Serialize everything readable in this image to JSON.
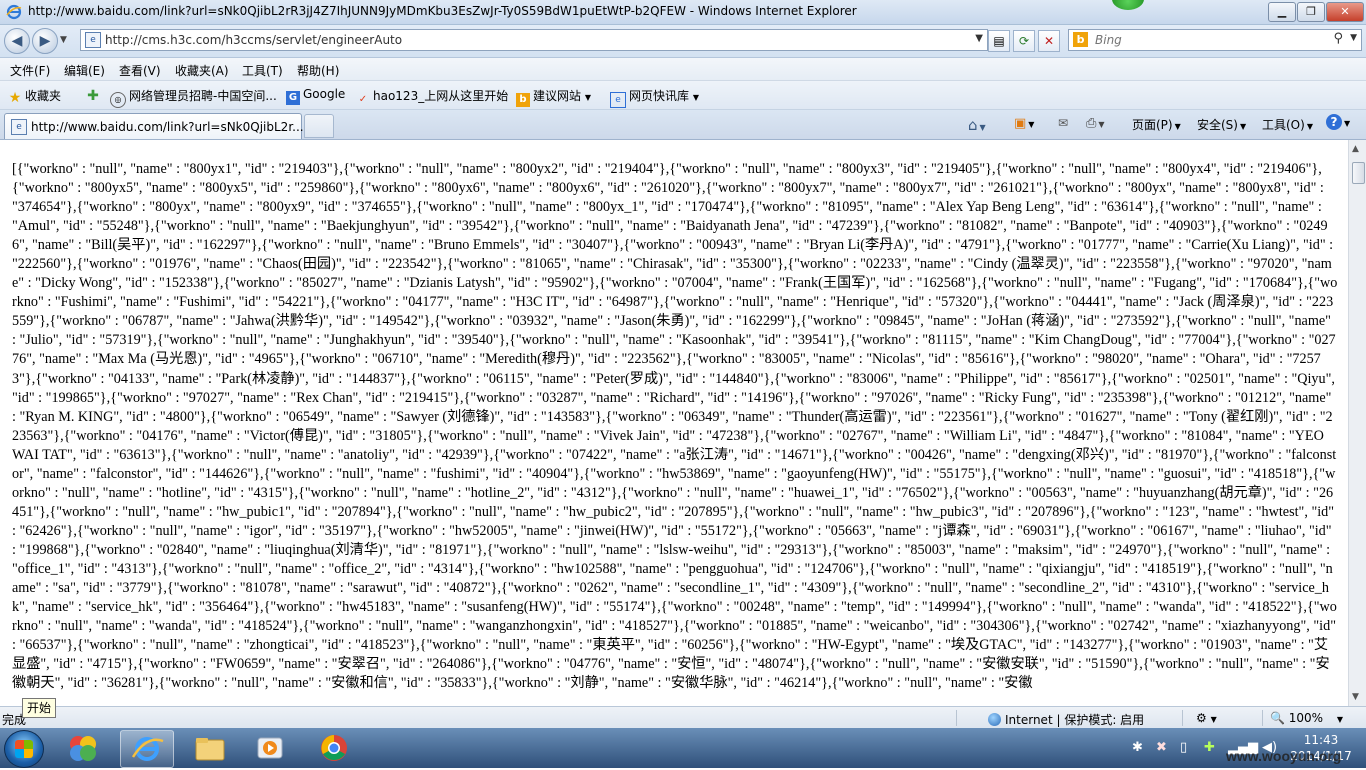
{
  "window": {
    "title": "http://www.baidu.com/link?url=sNk0QjibL2rR3jJ4Z7IhJUNN9JyMDmKbu3EsZwJr-Ty0S59BdW1puEtWtP-b2QFEW - Windows Internet Explorer"
  },
  "address": {
    "url": "http://cms.h3c.com/h3ccms/servlet/engineerAuto"
  },
  "search": {
    "placeholder": "Bing"
  },
  "menu": {
    "items": [
      "文件(F)",
      "编辑(E)",
      "查看(V)",
      "收藏夹(A)",
      "工具(T)",
      "帮助(H)"
    ]
  },
  "favorites": {
    "label": "收藏夹",
    "items": [
      "网络管理员招聘-中国空间...",
      "Google",
      "hao123_上网从这里开始",
      "建议网站",
      "网页快讯库"
    ]
  },
  "tab": {
    "label": "http://www.baidu.com/link?url=sNk0QjibL2r..."
  },
  "commandbar": {
    "page": "页面(P)",
    "safety": "安全(S)",
    "tools": "工具(O)"
  },
  "content": {
    "json_text": "[{\"workno\" : \"null\", \"name\" : \"800yx1\", \"id\" : \"219403\"},{\"workno\" : \"null\", \"name\" : \"800yx2\", \"id\" : \"219404\"},{\"workno\" : \"null\", \"name\" : \"800yx3\", \"id\" : \"219405\"},{\"workno\" : \"null\", \"name\" : \"800yx4\", \"id\" : \"219406\"},{\"workno\" : \"800yx5\", \"name\" : \"800yx5\", \"id\" : \"259860\"},{\"workno\" : \"800yx6\", \"name\" : \"800yx6\", \"id\" : \"261020\"},{\"workno\" : \"800yx7\", \"name\" : \"800yx7\", \"id\" : \"261021\"},{\"workno\" : \"800yx\", \"name\" : \"800yx8\", \"id\" : \"374654\"},{\"workno\" : \"800yx\", \"name\" : \"800yx9\", \"id\" : \"374655\"},{\"workno\" : \"null\", \"name\" : \"800yx_1\", \"id\" : \"170474\"},{\"workno\" : \"81095\", \"name\" : \"Alex Yap Beng Leng\", \"id\" : \"63614\"},{\"workno\" : \"null\", \"name\" : \"Amul\", \"id\" : \"55248\"},{\"workno\" : \"null\", \"name\" : \"Baekjunghyun\", \"id\" : \"39542\"},{\"workno\" : \"null\", \"name\" : \"Baidyanath Jena\", \"id\" : \"47239\"},{\"workno\" : \"81082\", \"name\" : \"Banpote\", \"id\" : \"40903\"},{\"workno\" : \"02496\", \"name\" : \"Bill(吴平)\", \"id\" : \"162297\"},{\"workno\" : \"null\", \"name\" : \"Bruno Emmels\", \"id\" : \"30407\"},{\"workno\" : \"00943\", \"name\" : \"Bryan Li(李丹A)\", \"id\" : \"4791\"},{\"workno\" : \"01777\", \"name\" : \"Carrie(Xu Liang)\", \"id\" : \"222560\"},{\"workno\" : \"01976\", \"name\" : \"Chaos(田园)\", \"id\" : \"223542\"},{\"workno\" : \"81065\", \"name\" : \"Chirasak\", \"id\" : \"35300\"},{\"workno\" : \"02233\", \"name\" : \"Cindy (温翠灵)\", \"id\" : \"223558\"},{\"workno\" : \"97020\", \"name\" : \"Dicky Wong\", \"id\" : \"152338\"},{\"workno\" : \"85027\", \"name\" : \"Dzianis Latysh\", \"id\" : \"95902\"},{\"workno\" : \"07004\", \"name\" : \"Frank(王国军)\", \"id\" : \"162568\"},{\"workno\" : \"null\", \"name\" : \"Fugang\", \"id\" : \"170684\"},{\"workno\" : \"Fushimi\", \"name\" : \"Fushimi\", \"id\" : \"54221\"},{\"workno\" : \"04177\", \"name\" : \"H3C IT\", \"id\" : \"64987\"},{\"workno\" : \"null\", \"name\" : \"Henrique\", \"id\" : \"57320\"},{\"workno\" : \"04441\", \"name\" : \"Jack (周泽泉)\", \"id\" : \"223559\"},{\"workno\" : \"06787\", \"name\" : \"Jahwa(洪黔华)\", \"id\" : \"149542\"},{\"workno\" : \"03932\", \"name\" : \"Jason(朱勇)\", \"id\" : \"162299\"},{\"workno\" : \"09845\", \"name\" : \"JoHan (蒋涵)\", \"id\" : \"273592\"},{\"workno\" : \"null\", \"name\" : \"Julio\", \"id\" : \"57319\"},{\"workno\" : \"null\", \"name\" : \"Junghakhyun\", \"id\" : \"39540\"},{\"workno\" : \"null\", \"name\" : \"Kasoonhak\", \"id\" : \"39541\"},{\"workno\" : \"81115\", \"name\" : \"Kim ChangDoug\", \"id\" : \"77004\"},{\"workno\" : \"02776\", \"name\" : \"Max Ma (马光恩)\", \"id\" : \"4965\"},{\"workno\" : \"06710\", \"name\" : \"Meredith(穆丹)\", \"id\" : \"223562\"},{\"workno\" : \"83005\", \"name\" : \"Nicolas\", \"id\" : \"85616\"},{\"workno\" : \"98020\", \"name\" : \"Ohara\", \"id\" : \"72573\"},{\"workno\" : \"04133\", \"name\" : \"Park(林凌静)\", \"id\" : \"144837\"},{\"workno\" : \"06115\", \"name\" : \"Peter(罗成)\", \"id\" : \"144840\"},{\"workno\" : \"83006\", \"name\" : \"Philippe\", \"id\" : \"85617\"},{\"workno\" : \"02501\", \"name\" : \"Qiyu\", \"id\" : \"199865\"},{\"workno\" : \"97027\", \"name\" : \"Rex Chan\", \"id\" : \"219415\"},{\"workno\" : \"03287\", \"name\" : \"Richard\", \"id\" : \"14196\"},{\"workno\" : \"97026\", \"name\" : \"Ricky Fung\", \"id\" : \"235398\"},{\"workno\" : \"01212\", \"name\" : \"Ryan M. KING\", \"id\" : \"4800\"},{\"workno\" : \"06549\", \"name\" : \"Sawyer (刘德锋)\", \"id\" : \"143583\"},{\"workno\" : \"06349\", \"name\" : \"Thunder(高运雷)\", \"id\" : \"223561\"},{\"workno\" : \"01627\", \"name\" : \"Tony (翟红刚)\", \"id\" : \"223563\"},{\"workno\" : \"04176\", \"name\" : \"Victor(傅昆)\", \"id\" : \"31805\"},{\"workno\" : \"null\", \"name\" : \"Vivek Jain\", \"id\" : \"47238\"},{\"workno\" : \"02767\", \"name\" : \"William Li\", \"id\" : \"4847\"},{\"workno\" : \"81084\", \"name\" : \"YEO WAI TAT\", \"id\" : \"63613\"},{\"workno\" : \"null\", \"name\" : \"anatoliy\", \"id\" : \"42939\"},{\"workno\" : \"07422\", \"name\" : \"a张江涛\", \"id\" : \"14671\"},{\"workno\" : \"00426\", \"name\" : \"dengxing(邓兴)\", \"id\" : \"81970\"},{\"workno\" : \"falconstor\", \"name\" : \"falconstor\", \"id\" : \"144626\"},{\"workno\" : \"null\", \"name\" : \"fushimi\", \"id\" : \"40904\"},{\"workno\" : \"hw53869\", \"name\" : \"gaoyunfeng(HW)\", \"id\" : \"55175\"},{\"workno\" : \"null\", \"name\" : \"guosui\", \"id\" : \"418518\"},{\"workno\" : \"null\", \"name\" : \"hotline\", \"id\" : \"4315\"},{\"workno\" : \"null\", \"name\" : \"hotline_2\", \"id\" : \"4312\"},{\"workno\" : \"null\", \"name\" : \"huawei_1\", \"id\" : \"76502\"},{\"workno\" : \"00563\", \"name\" : \"huyuanzhang(胡元章)\", \"id\" : \"26451\"},{\"workno\" : \"null\", \"name\" : \"hw_pubic1\", \"id\" : \"207894\"},{\"workno\" : \"null\", \"name\" : \"hw_pubic2\", \"id\" : \"207895\"},{\"workno\" : \"null\", \"name\" : \"hw_pubic3\", \"id\" : \"207896\"},{\"workno\" : \"123\", \"name\" : \"hwtest\", \"id\" : \"62426\"},{\"workno\" : \"null\", \"name\" : \"igor\", \"id\" : \"35197\"},{\"workno\" : \"hw52005\", \"name\" : \"jinwei(HW)\", \"id\" : \"55172\"},{\"workno\" : \"05663\", \"name\" : \"j谭森\", \"id\" : \"69031\"},{\"workno\" : \"06167\", \"name\" : \"liuhao\", \"id\" : \"199868\"},{\"workno\" : \"02840\", \"name\" : \"liuqinghua(刘清华)\", \"id\" : \"81971\"},{\"workno\" : \"null\", \"name\" : \"lslsw-weihu\", \"id\" : \"29313\"},{\"workno\" : \"85003\", \"name\" : \"maksim\", \"id\" : \"24970\"},{\"workno\" : \"null\", \"name\" : \"office_1\", \"id\" : \"4313\"},{\"workno\" : \"null\", \"name\" : \"office_2\", \"id\" : \"4314\"},{\"workno\" : \"hw102588\", \"name\" : \"pengguohua\", \"id\" : \"124706\"},{\"workno\" : \"null\", \"name\" : \"qixiangju\", \"id\" : \"418519\"},{\"workno\" : \"null\", \"name\" : \"sa\", \"id\" : \"3779\"},{\"workno\" : \"81078\", \"name\" : \"sarawut\", \"id\" : \"40872\"},{\"workno\" : \"0262\", \"name\" : \"secondline_1\", \"id\" : \"4309\"},{\"workno\" : \"null\", \"name\" : \"secondline_2\", \"id\" : \"4310\"},{\"workno\" : \"service_hk\", \"name\" : \"service_hk\", \"id\" : \"356464\"},{\"workno\" : \"hw45183\", \"name\" : \"susanfeng(HW)\", \"id\" : \"55174\"},{\"workno\" : \"00248\", \"name\" : \"temp\", \"id\" : \"149994\"},{\"workno\" : \"null\", \"name\" : \"wanda\", \"id\" : \"418522\"},{\"workno\" : \"null\", \"name\" : \"wanda\", \"id\" : \"418524\"},{\"workno\" : \"null\", \"name\" : \"wanganzhongxin\", \"id\" : \"418527\"},{\"workno\" : \"01885\", \"name\" : \"weicanbo\", \"id\" : \"304306\"},{\"workno\" : \"02742\", \"name\" : \"xiazhanyyong\", \"id\" : \"66537\"},{\"workno\" : \"null\", \"name\" : \"zhongticai\", \"id\" : \"418523\"},{\"workno\" : \"null\", \"name\" : \"東英平\", \"id\" : \"60256\"},{\"workno\" : \"HW-Egypt\", \"name\" : \"埃及GTAC\", \"id\" : \"143277\"},{\"workno\" : \"01903\", \"name\" : \"艾显盛\", \"id\" : \"4715\"},{\"workno\" : \"FW0659\", \"name\" : \"安翠召\", \"id\" : \"264086\"},{\"workno\" : \"04776\", \"name\" : \"安恒\", \"id\" : \"48074\"},{\"workno\" : \"null\", \"name\" : \"安徽安联\", \"id\" : \"51590\"},{\"workno\" : \"null\", \"name\" : \"安徽朝天\", \"id\" : \"36281\"},{\"workno\" : \"null\", \"name\" : \"安徽和信\", \"id\" : \"35833\"},{\"workno\" : \"刘静\", \"name\" : \"安徽华脉\", \"id\" : \"46214\"},{\"workno\" : \"null\", \"name\" : \"安徽"
  },
  "status": {
    "text": "完成",
    "tooltip": "开始",
    "zone": "Internet | 保护模式: 启用",
    "zoom": "100%"
  },
  "taskbar": {
    "time": "11:43",
    "date": "2014/1/17"
  },
  "watermark": "www.wooyun.org"
}
